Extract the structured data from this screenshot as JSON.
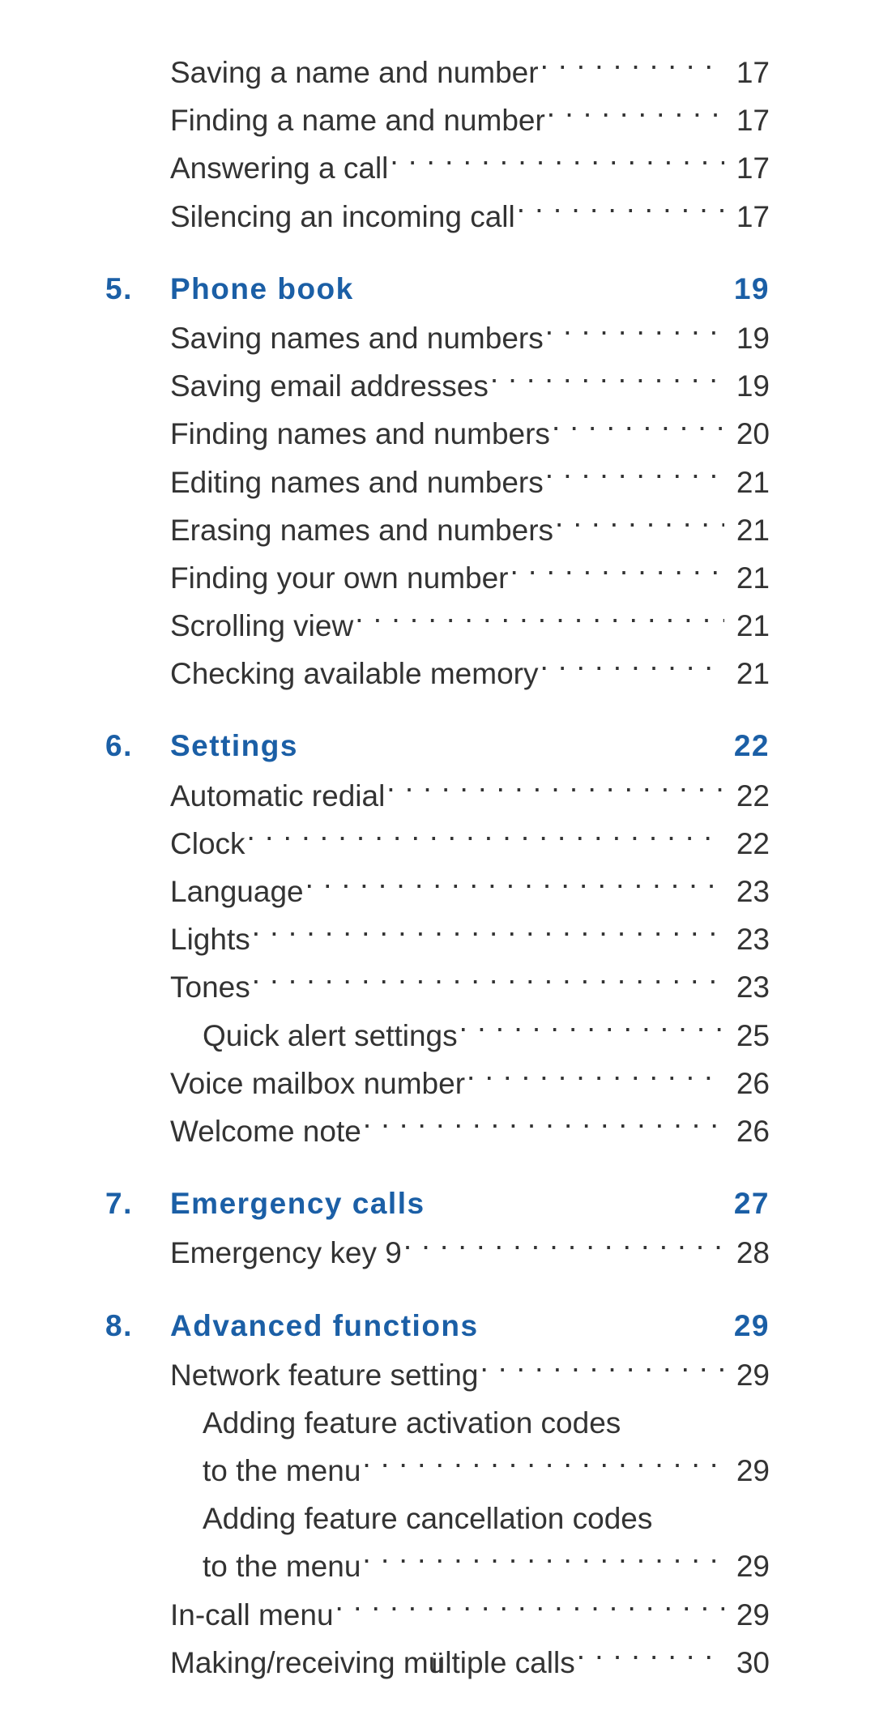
{
  "accent_color": "#1b5fa6",
  "text_color": "#333333",
  "page_number": "ii",
  "orphan_entries": [
    {
      "title": "Saving a name and number",
      "page": "17"
    },
    {
      "title": "Finding a name and number",
      "page": "17"
    },
    {
      "title": "Answering a call",
      "page": "17"
    },
    {
      "title": "Silencing an incoming call",
      "page": "17"
    }
  ],
  "sections": [
    {
      "number": "5.",
      "title": "Phone book",
      "page": "19",
      "entries": [
        {
          "title": "Saving names and numbers",
          "page": "19"
        },
        {
          "title": "Saving email addresses",
          "page": "19"
        },
        {
          "title": "Finding names and numbers",
          "page": "20"
        },
        {
          "title": "Editing names and numbers",
          "page": "21"
        },
        {
          "title": "Erasing names and numbers",
          "page": "21"
        },
        {
          "title": "Finding your own number",
          "page": "21"
        },
        {
          "title": "Scrolling view",
          "page": "21"
        },
        {
          "title": "Checking available memory",
          "page": "21"
        }
      ]
    },
    {
      "number": "6.",
      "title": "Settings",
      "page": "22",
      "entries": [
        {
          "title": "Automatic redial",
          "page": "22"
        },
        {
          "title": "Clock",
          "page": "22"
        },
        {
          "title": "Language",
          "page": "23"
        },
        {
          "title": "Lights",
          "page": "23"
        },
        {
          "title": "Tones",
          "page": "23"
        },
        {
          "title": "Quick alert settings",
          "page": "25",
          "indent": true
        },
        {
          "title": "Voice mailbox number",
          "page": "26"
        },
        {
          "title": "Welcome note",
          "page": "26"
        }
      ]
    },
    {
      "number": "7.",
      "title": "Emergency calls",
      "page": "27",
      "entries": [
        {
          "title": "Emergency key 9",
          "page": "28"
        }
      ]
    },
    {
      "number": "8.",
      "title": "Advanced functions",
      "page": "29",
      "entries": [
        {
          "title": "Network feature setting",
          "page": "29"
        },
        {
          "title_line1": "Adding feature activation codes",
          "title_line2": "to the menu",
          "page": "29",
          "indent": true,
          "wrap": true
        },
        {
          "title_line1": "Adding feature cancellation codes",
          "title_line2": "to the menu",
          "page": "29",
          "indent": true,
          "wrap": true
        },
        {
          "title": "In-call menu",
          "page": "29"
        },
        {
          "title": "Making/receiving multiple calls",
          "page": "30"
        }
      ]
    }
  ]
}
